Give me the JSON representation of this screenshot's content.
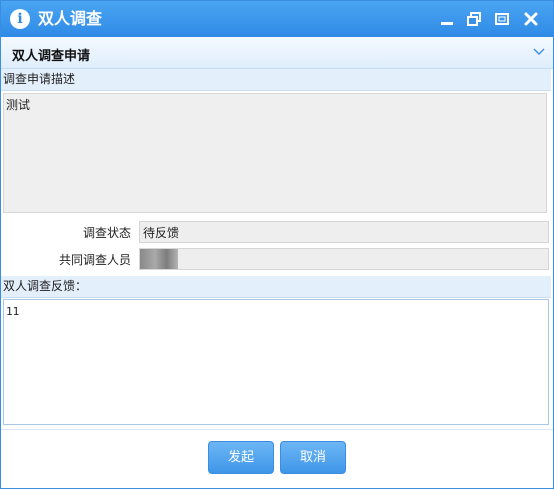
{
  "window": {
    "title": "双人调查",
    "info_icon_glyph": "i",
    "controls": [
      "minimize-icon",
      "restore-icon",
      "maximize-icon",
      "close-icon"
    ],
    "accent_color": "#2f8ae6"
  },
  "panel": {
    "title": "双人调查申请",
    "collapse_icon": "chevron-down-icon"
  },
  "description": {
    "label": "调查申请描述",
    "value": "测试"
  },
  "status": {
    "label": "调查状态",
    "value": "待反馈"
  },
  "collaborator": {
    "label": "共同调查人员",
    "value": ""
  },
  "feedback": {
    "label": "双人调查反馈：",
    "value": "11"
  },
  "buttons": {
    "submit": "发起",
    "cancel": "取消"
  }
}
